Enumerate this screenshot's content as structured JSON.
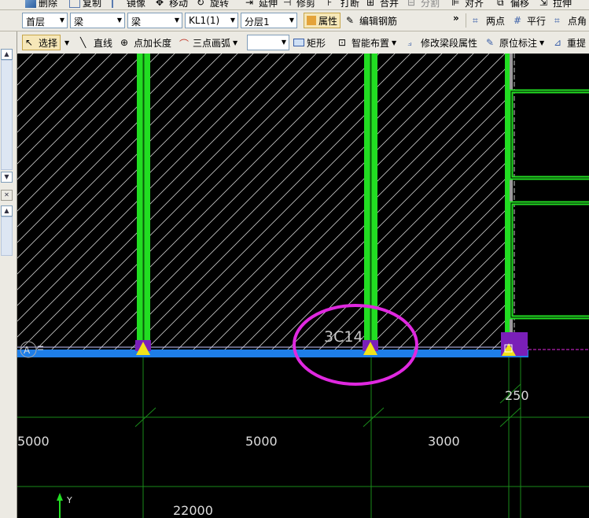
{
  "toolbar_top": {
    "delete": "删除",
    "copy": "复制",
    "mirror": "镜像",
    "move": "移动",
    "rotate": "旋转",
    "extend": "延伸",
    "trim": "修剪",
    "break": "打断",
    "merge": "合并",
    "split": "分割",
    "align": "对齐",
    "offset": "偏移",
    "stretch": "拉伸"
  },
  "toolbar_selectors": {
    "floor": "首层",
    "type": "梁",
    "subtype": "梁",
    "component": "KL1(1)",
    "layer": "分层1",
    "properties": "属性",
    "edit_rebar": "编辑钢筋",
    "more": "»",
    "two_points": "两点",
    "parallel": "平行",
    "point_angle": "点角"
  },
  "toolbar_draw": {
    "select": "选择",
    "line": "直线",
    "point_length": "点加长度",
    "three_point_arc": "三点画弧",
    "rectangle": "矩形",
    "smart_layout": "智能布置",
    "modify_span_props": "修改梁段属性",
    "inplace_annotation": "原位标注",
    "reextract": "重提"
  },
  "canvas": {
    "rebar_label": "3C14",
    "dims_top": [
      "5000",
      "5000",
      "3000"
    ],
    "dim_small": "250",
    "dim_total": "22000",
    "axis_y": "Y",
    "colors": {
      "beam": "#22dd22",
      "wall_blue": "#1e7ee8",
      "axis": "#1a8a1a",
      "highlight": "#e028e0",
      "support": "#f2e21a",
      "hatch": "#c8c8c8"
    }
  }
}
